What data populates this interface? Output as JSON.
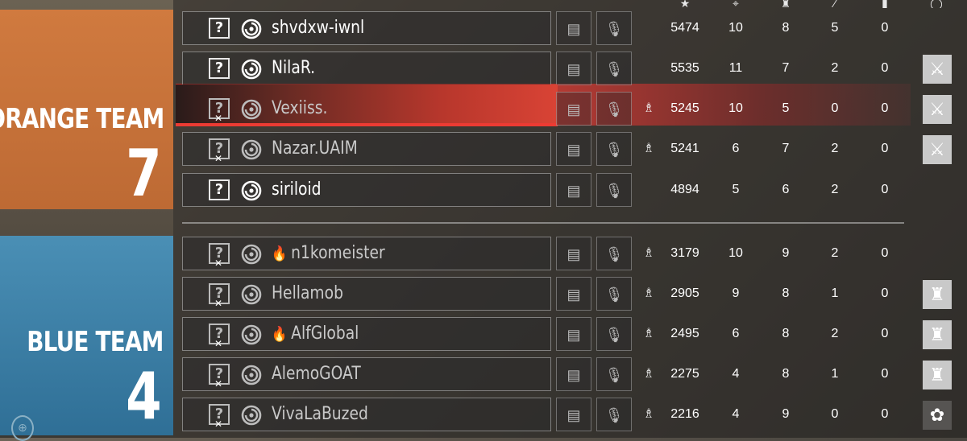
{
  "teams": {
    "orange": {
      "name": "ORANGE TEAM",
      "score": "7",
      "color": "#c97139"
    },
    "blue": {
      "name": "BLUE TEAM",
      "score": "4",
      "color": "#3b7fa8"
    }
  },
  "columns": [
    "score-icon",
    "kills-icon",
    "assists-icon",
    "deaths-icon",
    "ping-icon",
    "status-icon"
  ],
  "orange_players": [
    {
      "name": "shvdxw-iwnl",
      "flame": false,
      "alive": true,
      "defuser": false,
      "score": "5474",
      "kills": "10",
      "assists": "8",
      "deaths": "5",
      "ping": "0",
      "status": ""
    },
    {
      "name": "NilaR.",
      "flame": false,
      "alive": true,
      "defuser": false,
      "score": "5535",
      "kills": "11",
      "assists": "7",
      "deaths": "2",
      "ping": "0",
      "status": "swords-icon"
    },
    {
      "name": "Vexiiss.",
      "flame": false,
      "alive": false,
      "defuser": true,
      "score": "5245",
      "kills": "10",
      "assists": "5",
      "deaths": "0",
      "ping": "0",
      "status": "swords-icon",
      "self": true
    },
    {
      "name": "Nazar.UAIM",
      "flame": false,
      "alive": false,
      "defuser": true,
      "score": "5241",
      "kills": "6",
      "assists": "7",
      "deaths": "2",
      "ping": "0",
      "status": "swords-icon"
    },
    {
      "name": "siriloid",
      "flame": false,
      "alive": true,
      "defuser": false,
      "score": "4894",
      "kills": "5",
      "assists": "6",
      "deaths": "2",
      "ping": "0",
      "status": ""
    }
  ],
  "blue_players": [
    {
      "name": "n1komeister",
      "flame": true,
      "alive": false,
      "defuser": true,
      "score": "3179",
      "kills": "10",
      "assists": "9",
      "deaths": "2",
      "ping": "0",
      "status": ""
    },
    {
      "name": "Hellamob",
      "flame": false,
      "alive": false,
      "defuser": true,
      "score": "2905",
      "kills": "9",
      "assists": "8",
      "deaths": "1",
      "ping": "0",
      "status": "tower-icon"
    },
    {
      "name": "AlfGlobal",
      "flame": true,
      "alive": false,
      "defuser": true,
      "score": "2495",
      "kills": "6",
      "assists": "8",
      "deaths": "2",
      "ping": "0",
      "status": "tower-icon"
    },
    {
      "name": "AlemoGOAT",
      "flame": false,
      "alive": false,
      "defuser": true,
      "score": "2275",
      "kills": "4",
      "assists": "8",
      "deaths": "1",
      "ping": "0",
      "status": "tower-icon"
    },
    {
      "name": "VivaLaBuzed",
      "flame": false,
      "alive": false,
      "defuser": true,
      "score": "2216",
      "kills": "4",
      "assists": "9",
      "deaths": "0",
      "ping": "0",
      "status": "lotus-icon"
    }
  ]
}
